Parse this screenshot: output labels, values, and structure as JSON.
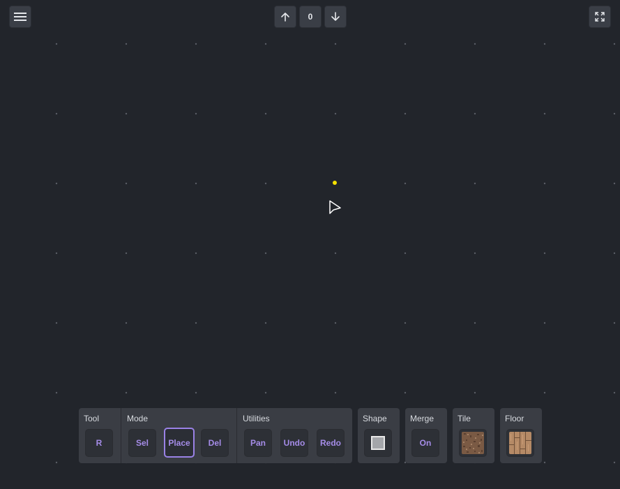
{
  "top": {
    "floor_level": "0",
    "menu_icon": "hamburger-menu-icon",
    "up_icon": "arrow-up-icon",
    "down_icon": "arrow-down-icon",
    "fullscreen_icon": "fullscreen-icon"
  },
  "toolbar": {
    "tool": {
      "label": "Tool",
      "buttons": [
        "R"
      ]
    },
    "mode": {
      "label": "Mode",
      "buttons": [
        "Sel",
        "Place",
        "Del"
      ],
      "active": "Place"
    },
    "utilities": {
      "label": "Utilities",
      "buttons": [
        "Pan",
        "Undo",
        "Redo"
      ]
    },
    "shape": {
      "label": "Shape"
    },
    "merge": {
      "label": "Merge",
      "value": "On"
    },
    "tile": {
      "label": "Tile"
    },
    "floor": {
      "label": "Floor"
    }
  },
  "colors": {
    "background": "#22252b",
    "grid_dot": "#5a5e66",
    "accent": "#a58ce8",
    "marker": "#f5e100",
    "panel": "#3a3d44"
  }
}
